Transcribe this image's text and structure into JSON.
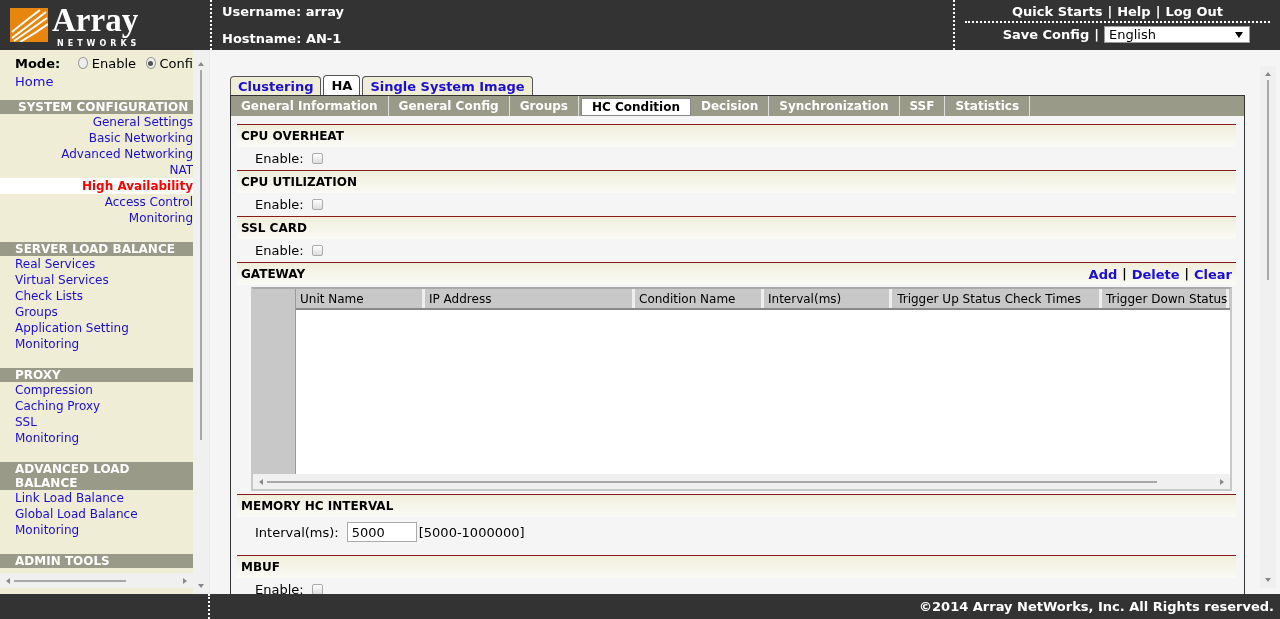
{
  "header": {
    "logo": {
      "name": "Array",
      "tagline": "NETWORKS"
    },
    "username": "Username: array",
    "hostname": "Hostname: AN-1",
    "links": [
      "Quick Starts",
      "Help",
      "Log Out"
    ],
    "separator": "|",
    "save_config": "Save Config",
    "language": "English"
  },
  "sidebar": {
    "mode_label": "Mode:",
    "modes": [
      {
        "label": "Enable",
        "selected": false
      },
      {
        "label": "Confi",
        "selected": true
      }
    ],
    "home": "Home",
    "sections": [
      {
        "title": "SYSTEM CONFIGURATION",
        "kind": "right",
        "items": [
          {
            "label": "General Settings",
            "selected": false
          },
          {
            "label": "Basic Networking",
            "selected": false
          },
          {
            "label": "Advanced Networking",
            "selected": false
          },
          {
            "label": "NAT",
            "selected": false
          },
          {
            "label": "High Availability",
            "selected": true
          },
          {
            "label": "Access Control",
            "selected": false
          },
          {
            "label": "Monitoring",
            "selected": false
          }
        ]
      },
      {
        "title": "SERVER LOAD BALANCE",
        "kind": "left",
        "items": [
          {
            "label": "Real Services",
            "selected": false
          },
          {
            "label": "Virtual Services",
            "selected": false
          },
          {
            "label": "Check Lists",
            "selected": false
          },
          {
            "label": "Groups",
            "selected": false
          },
          {
            "label": "Application Setting",
            "selected": false
          },
          {
            "label": "Monitoring",
            "selected": false
          }
        ]
      },
      {
        "title": "PROXY",
        "kind": "left",
        "items": [
          {
            "label": "Compression",
            "selected": false
          },
          {
            "label": "Caching Proxy",
            "selected": false
          },
          {
            "label": "SSL",
            "selected": false
          },
          {
            "label": "Monitoring",
            "selected": false
          }
        ]
      },
      {
        "title": "ADVANCED LOAD BALANCE",
        "kind": "left",
        "items": [
          {
            "label": "Link Load Balance",
            "selected": false
          },
          {
            "label": "Global Load Balance",
            "selected": false
          },
          {
            "label": "Monitoring",
            "selected": false
          }
        ]
      },
      {
        "title": "ADMIN TOOLS",
        "kind": "left"
      }
    ]
  },
  "top_tabs": [
    {
      "label": "Clustering",
      "selected": false
    },
    {
      "label": "HA",
      "selected": true
    },
    {
      "label": "Single System Image",
      "selected": false
    }
  ],
  "sub_tabs": [
    {
      "label": "General Information",
      "selected": false
    },
    {
      "label": "General Config",
      "selected": false
    },
    {
      "label": "Groups",
      "selected": false
    },
    {
      "label": "HC Condition",
      "selected": true
    },
    {
      "label": "Decision",
      "selected": false
    },
    {
      "label": "Synchronization",
      "selected": false
    },
    {
      "label": "SSF",
      "selected": false
    },
    {
      "label": "Statistics",
      "selected": false
    }
  ],
  "sections": [
    {
      "title": "CPU OVERHEAT",
      "kind": "checkbox",
      "label": "Enable:",
      "checked": false
    },
    {
      "title": "CPU UTILIZATION",
      "kind": "checkbox",
      "label": "Enable:",
      "checked": false
    },
    {
      "title": "SSL CARD",
      "kind": "checkbox",
      "label": "Enable:",
      "checked": false
    },
    {
      "title": "GATEWAY",
      "kind": "grid",
      "actions": [
        "Add",
        "Delete",
        "Clear"
      ],
      "separator": "|",
      "columns": [
        "Unit Name",
        "IP Address",
        "Condition Name",
        "Interval(ms)",
        "Trigger Up Status Check Times",
        "Trigger Down Status"
      ]
    },
    {
      "title": "MEMORY HC INTERVAL",
      "kind": "input",
      "label": "Interval(ms):",
      "value": "5000",
      "hint": "[5000-1000000]"
    },
    {
      "title": "MBUF",
      "kind": "checkbox",
      "label": "Enable:",
      "checked": false
    }
  ],
  "footer": "©2014 Array NetWorks, Inc. All Rights reserved."
}
